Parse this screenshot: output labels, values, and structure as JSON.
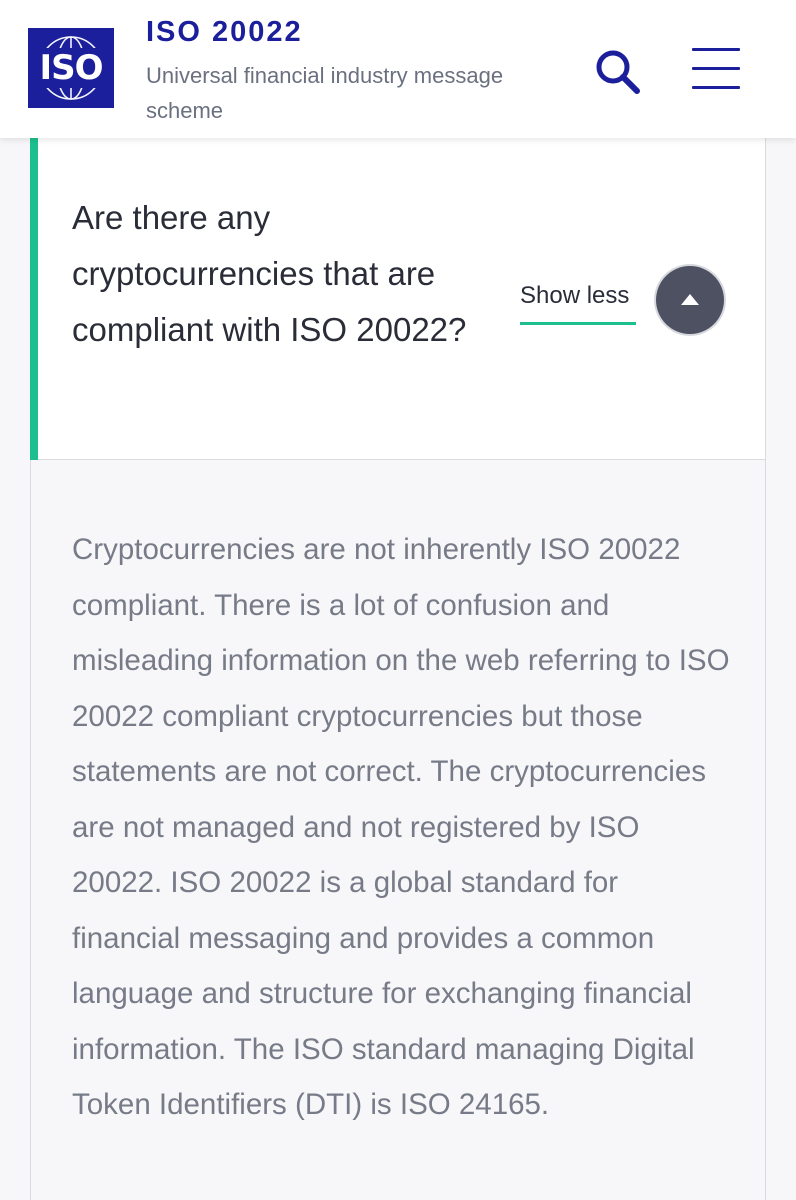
{
  "header": {
    "logo_text": "ISO",
    "title": "ISO 20022",
    "subtitle": "Universal financial industry message scheme",
    "search_icon": "search-icon",
    "menu_icon": "hamburger-menu-icon",
    "brand_color": "#1c1f9c"
  },
  "faq": {
    "question": "Are there any cryptocurrencies that are compliant with ISO 20022?",
    "toggle_label": "Show less",
    "toggle_icon": "chevron-up-icon",
    "accent_color": "#1ebf8f",
    "answer": "Cryptocurrencies are not inherently ISO 20022 compliant. There is a lot of confusion and misleading information on the web referring to ISO 20022 compliant cryptocurrencies but those statements are not correct. The cryptocurrencies are not managed and not registered by ISO 20022. ISO 20022 is a global standard for financial messaging and provides a common language and structure for exchanging financial information. The ISO standard managing Digital Token Identifiers (DTI) is ISO 24165."
  }
}
